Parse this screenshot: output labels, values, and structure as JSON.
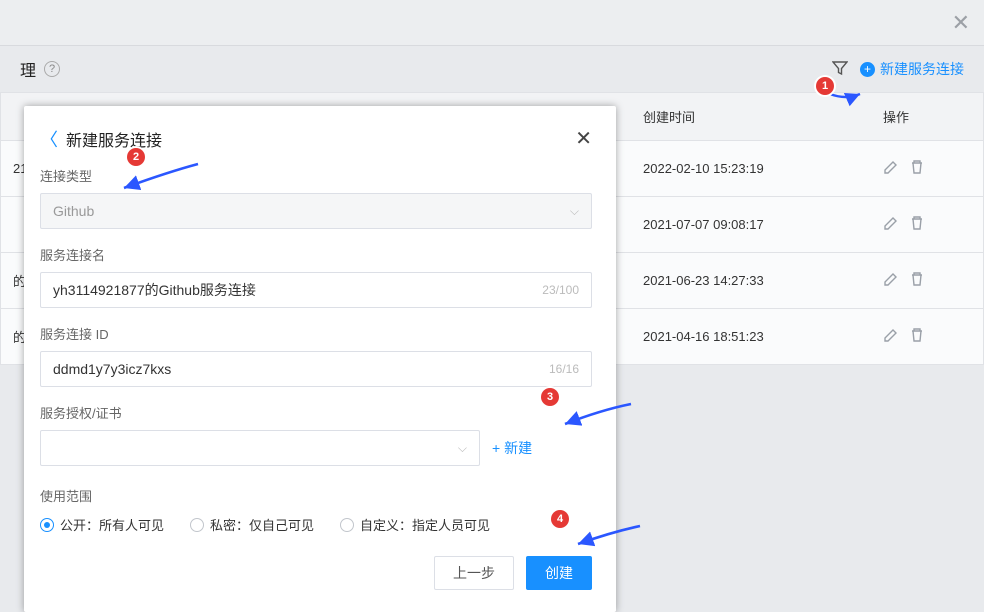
{
  "header_close_icon": "✕",
  "page_title": "理",
  "help_icon": "?",
  "filter_icon_name": "filter-icon",
  "new_conn_label": "新建服务连接",
  "table": {
    "headers": {
      "type": "",
      "date": "创建时间",
      "op": "操作"
    },
    "rows": [
      {
        "type_trunc": "21",
        "date": "2022-02-10 15:23:19"
      },
      {
        "type_trunc": "",
        "date": "2021-07-07 09:08:17"
      },
      {
        "type_trunc": "的",
        "date": "2021-06-23 14:27:33"
      },
      {
        "type_trunc": "的",
        "date": "2021-04-16 18:51:23"
      }
    ]
  },
  "modal": {
    "title": "新建服务连接",
    "labels": {
      "type": "连接类型",
      "name": "服务连接名",
      "id": "服务连接 ID",
      "auth": "服务授权/证书",
      "scope": "使用范围"
    },
    "type_value": "Github",
    "name_value": "yh3114921877的Github服务连接",
    "name_count": "23/100",
    "id_value": "ddmd1y7y3icz7kxs",
    "id_count": "16/16",
    "new_auth": "+ 新建",
    "scope_options": {
      "public": "公开：所有人可见",
      "private": "私密：仅自己可见",
      "custom": "自定义：指定人员可见"
    },
    "buttons": {
      "prev": "上一步",
      "create": "创建"
    }
  },
  "annotations": {
    "1": "1",
    "2": "2",
    "3": "3",
    "4": "4"
  }
}
